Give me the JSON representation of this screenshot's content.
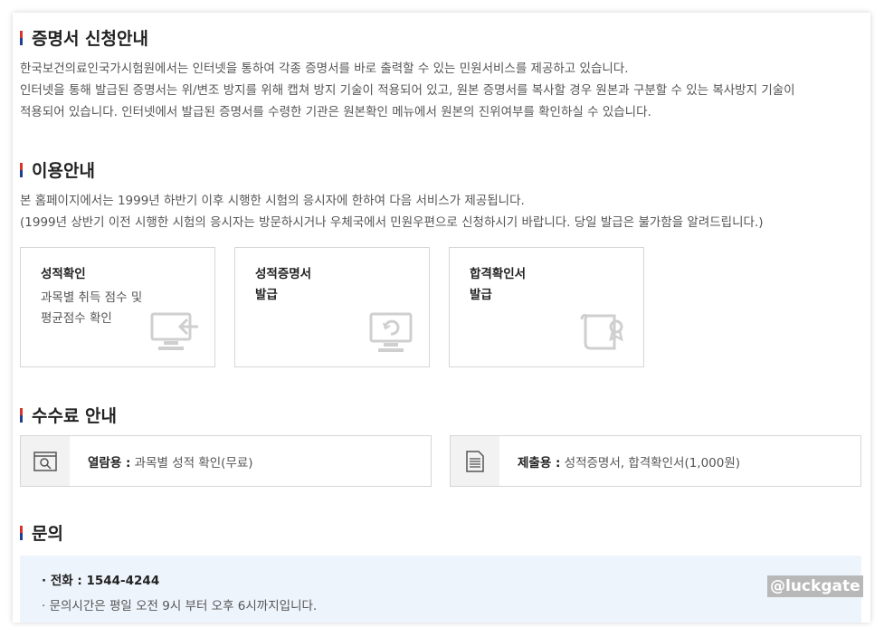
{
  "sections": {
    "intro": {
      "title": "증명서 신청안내",
      "lines": [
        "한국보건의료인국가시험원에서는 인터넷을 통하여 각종 증명서를 바로 출력할 수 있는 민원서비스를 제공하고 있습니다.",
        "인터넷을 통해 발급된 증명서는 위/변조 방지를 위해 캡쳐 방지 기술이 적용되어 있고, 원본 증명서를 복사할 경우 원본과 구분할 수 있는 복사방지 기술이",
        "적용되어 있습니다. 인터넷에서 발급된 증명서를 수령한 기관은 원본확인 메뉴에서 원본의 진위여부를 확인하실 수 있습니다."
      ]
    },
    "usage": {
      "title": "이용안내",
      "lines": [
        "본 홈페이지에서는 1999년 하반기 이후 시행한 시험의 응시자에 한하여 다음 서비스가 제공됩니다.",
        "(1999년 상반기 이전 시행한 시험의 응시자는 방문하시거나 우체국에서 민원우편으로 신청하시기 바랍니다. 당일 발급은 불가함을 알려드립니다.)"
      ],
      "services": [
        {
          "title_lines": [
            "성적확인"
          ],
          "desc_lines": [
            "과목별 취득 점수 및",
            "평균점수 확인"
          ],
          "icon": "monitor-arrow-icon"
        },
        {
          "title_lines": [
            "성적증명서",
            "발급"
          ],
          "desc_lines": [],
          "icon": "monitor-refresh-icon"
        },
        {
          "title_lines": [
            "합격확인서",
            "발급"
          ],
          "desc_lines": [],
          "icon": "certificate-scroll-icon"
        }
      ]
    },
    "fees": {
      "title": "수수료 안내",
      "items": [
        {
          "label": "열람용 :",
          "value": "과목별 성적 확인(무료)",
          "icon": "browser-search-icon"
        },
        {
          "label": "제출용 :",
          "value": "성적증명서, 합격확인서(1,000원)",
          "icon": "document-icon"
        }
      ]
    },
    "contact": {
      "title": "문의",
      "phone": "· 전화 : 1544-4244",
      "hours": "· 문의시간은 평일 오전 9시 부터 오후 6시까지입니다."
    }
  },
  "watermark": "@luckgate",
  "colors": {
    "title_bar_top": "#d9342b",
    "title_bar_bottom": "#1d3f8f",
    "contact_bg": "#eef4fc",
    "icon_gray": "#cfcfcf"
  }
}
